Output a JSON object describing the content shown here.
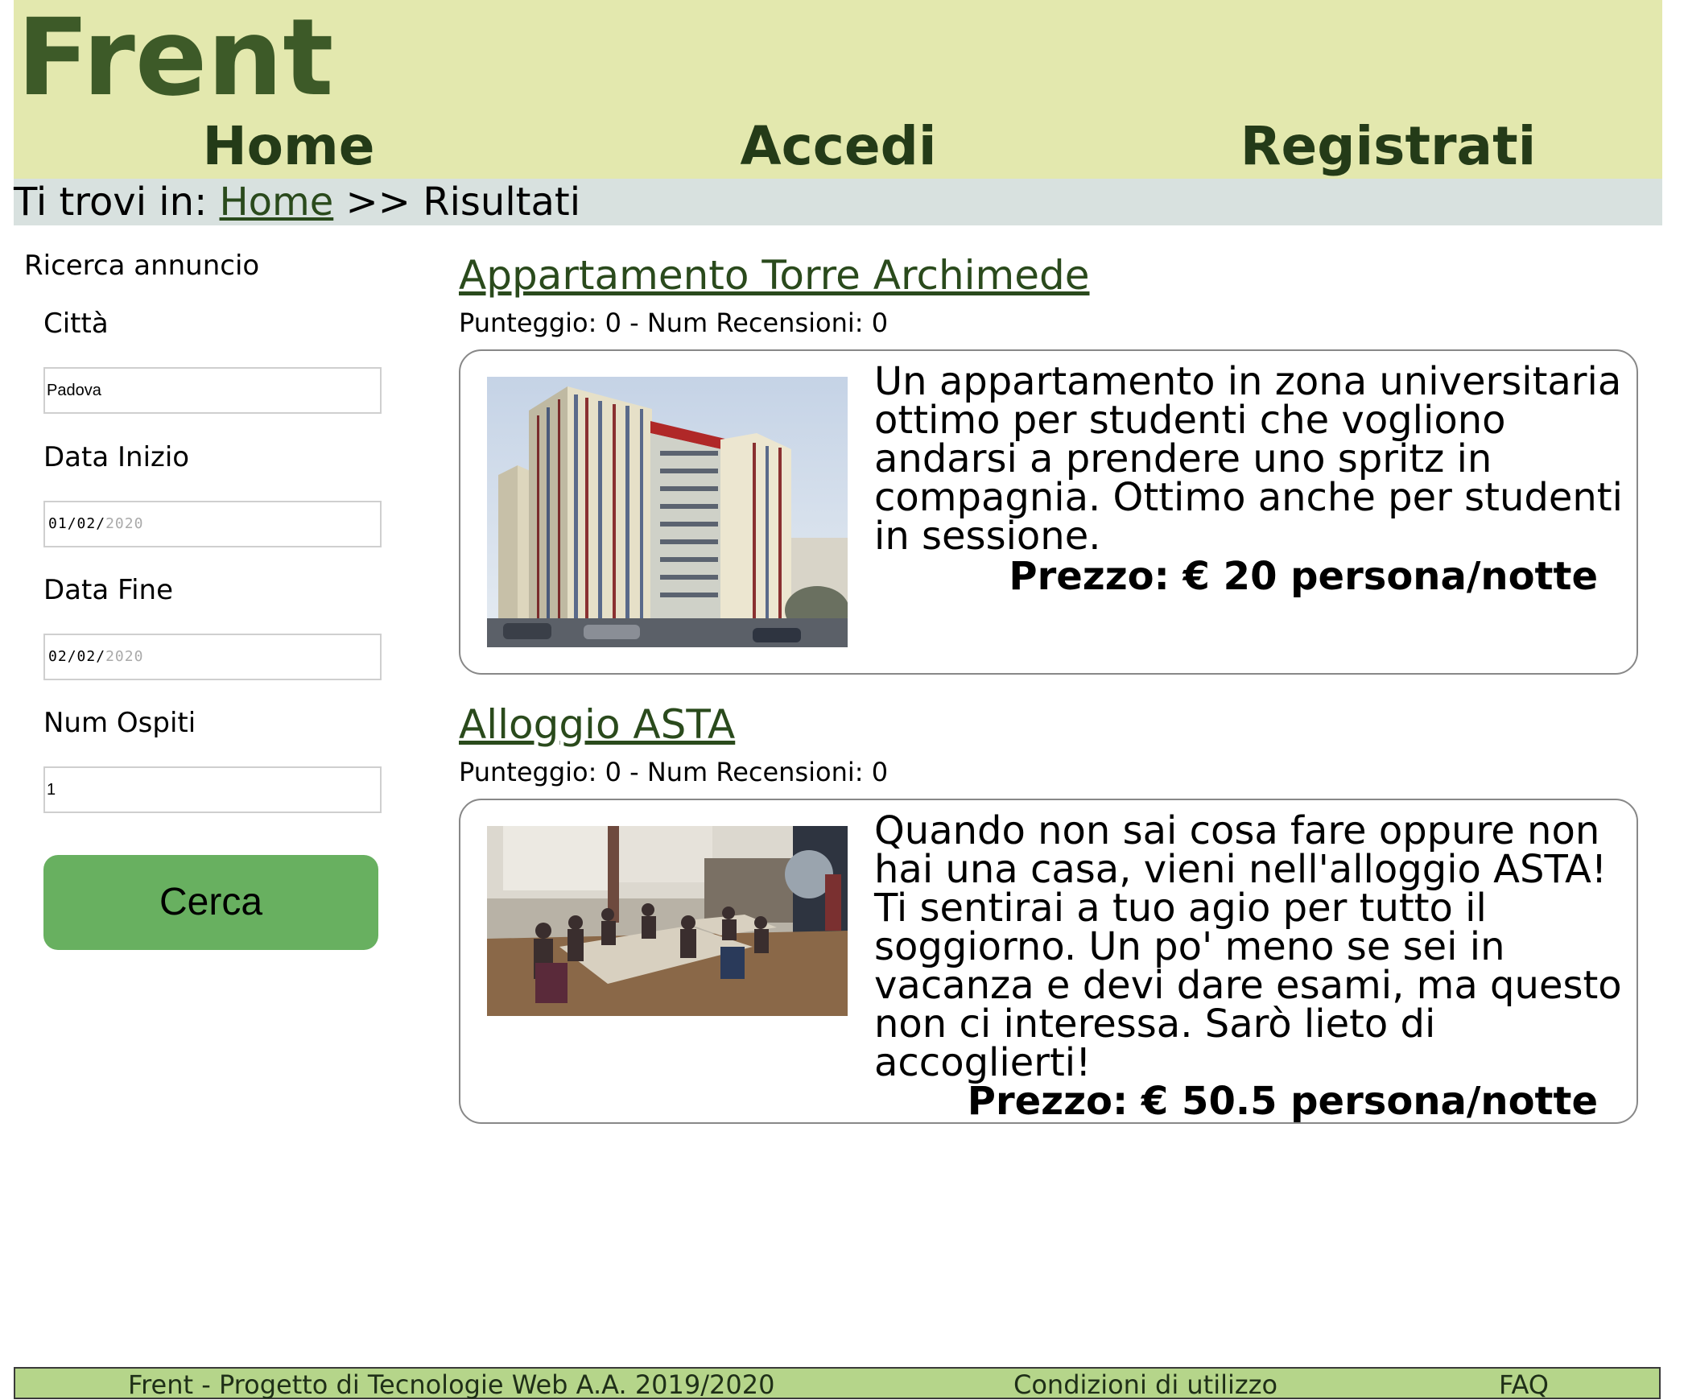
{
  "header": {
    "logo": "Frent",
    "nav": [
      "Home",
      "Accedi",
      "Registrati"
    ]
  },
  "breadcrumb": {
    "prefix": "Ti trovi in:",
    "home_link": "Home",
    "separator": ">>",
    "current": "Risultati"
  },
  "search": {
    "title": "Ricerca annuncio",
    "city_label": "Città",
    "city_value": "Padova",
    "start_label": "Data Inizio",
    "start_day": "01",
    "start_month": "02",
    "start_year": "2020",
    "end_label": "Data Fine",
    "end_day": "02",
    "end_month": "02",
    "end_year": "2020",
    "guests_label": "Num Ospiti",
    "guests_value": "1",
    "button": "Cerca"
  },
  "listings": [
    {
      "title": "Appartamento Torre Archimede",
      "score": "Punteggio: 0 - Num Recensioni: 0",
      "description": "Un appartamento in zona universitaria ottimo per studenti che vogliono andarsi a prendere uno spritz in compagnia. Ottimo anche per studenti in sessione.",
      "price": "Prezzo: € 20 persona/notte"
    },
    {
      "title": "Alloggio ASTA",
      "score": "Punteggio: 0 - Num Recensioni: 0",
      "description": "Quando non sai cosa fare oppure non hai una casa, vieni nell'alloggio ASTA! Ti sentirai a tuo agio per tutto il soggiorno. Un po' meno se sei in vacanza e devi dare esami, ma questo non ci interessa. Sarò lieto di accoglierti!",
      "price": "Prezzo: € 50.5 persona/notte"
    }
  ],
  "footer": {
    "project": "Frent - Progetto di Tecnologie Web A.A. 2019/2020",
    "terms": "Condizioni di utilizzo",
    "faq": "FAQ"
  }
}
